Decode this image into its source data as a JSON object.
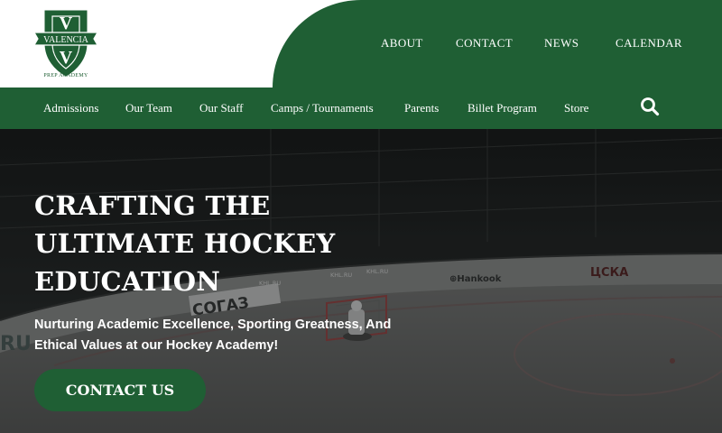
{
  "brand": {
    "logo_letter": "V",
    "logo_banner": "VALENCIA",
    "logo_caption": "PREP ACADEMY",
    "colors": {
      "primary_green": "#1f5f34",
      "white": "#ffffff"
    }
  },
  "top_nav": {
    "items": [
      {
        "label": "ABOUT"
      },
      {
        "label": "CONTACT"
      },
      {
        "label": "NEWS"
      },
      {
        "label": "CALENDAR"
      }
    ]
  },
  "sub_nav": {
    "items": [
      {
        "label": "Admissions"
      },
      {
        "label": "Our Team"
      },
      {
        "label": "Our Staff"
      },
      {
        "label": "Camps / Tournaments"
      },
      {
        "label": "Parents"
      },
      {
        "label": "Billet Program"
      },
      {
        "label": "Store"
      }
    ],
    "search_icon": "search-icon"
  },
  "hero": {
    "title_lines": [
      "CRAFTING THE",
      "ULTIMATE HOCKEY",
      "EDUCATION"
    ],
    "subtitle_lines": [
      "Nurturing Academic Excellence, Sporting Greatness, And",
      "Ethical Values at our Hockey Academy!"
    ],
    "cta_label": "CONTACT US",
    "background_signs": {
      "sogaz": "СОГАЗ",
      "hankook": "⊕Hankook",
      "cska": "ЦСКА",
      "khl_1": "KHL.RU",
      "khl_2": "KHL.RU",
      "khl_3": "KHL.RU",
      "ru_left": "RU"
    }
  }
}
